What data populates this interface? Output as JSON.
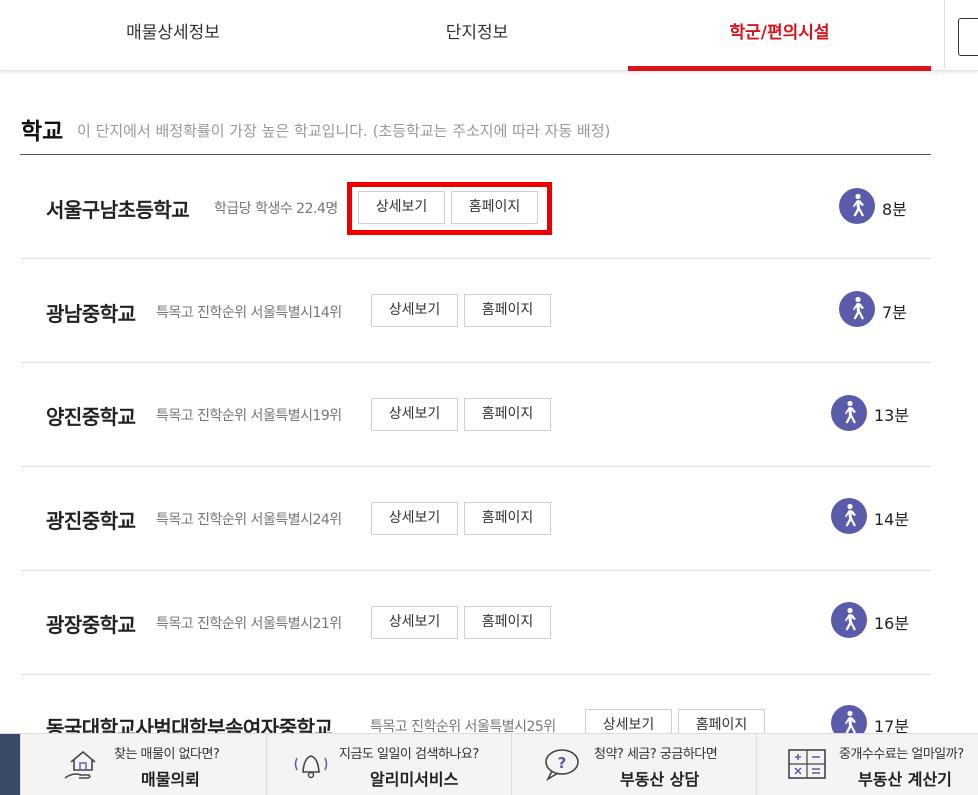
{
  "tabs": [
    {
      "label": "매물상세정보"
    },
    {
      "label": "단지정보"
    },
    {
      "label": "학군/편의시설"
    }
  ],
  "section": {
    "title": "학교",
    "description": "이 단지에서 배정확률이 가장 높은 학교입니다. (초등학교는 주소지에 따라 자동 배정)"
  },
  "buttons": {
    "detail": "상세보기",
    "homepage": "홈페이지"
  },
  "schools": [
    {
      "name": "서울구남초등학교",
      "info": "학급당 학생수 22.4명",
      "minutes": "8분"
    },
    {
      "name": "광남중학교",
      "info": "특목고 진학순위 서울특별시14위",
      "minutes": "7분"
    },
    {
      "name": "양진중학교",
      "info": "특목고 진학순위 서울특별시19위",
      "minutes": "13분"
    },
    {
      "name": "광진중학교",
      "info": "특목고 진학순위 서울특별시24위",
      "minutes": "14분"
    },
    {
      "name": "광장중학교",
      "info": "특목고 진학순위 서울특별시21위",
      "minutes": "16분"
    },
    {
      "name": "동국대학교사범대학부속여자중학교",
      "info": "특목고 진학순위 서울특별시25위",
      "minutes": "17분"
    }
  ],
  "bottom_bar": [
    {
      "sub": "찾는 매물이 없다면?",
      "main": "매물의뢰",
      "icon": "house-hand-icon"
    },
    {
      "sub": "지금도 일일이 검색하나요?",
      "main": "알리미서비스",
      "icon": "bell-icon"
    },
    {
      "sub": "청약? 세금? 궁금하다면",
      "main": "부동산 상담",
      "icon": "question-bubble-icon"
    },
    {
      "sub": "중개수수료는 얼마일까?",
      "main": "부동산 계산기",
      "icon": "calculator-icon"
    }
  ],
  "colors": {
    "accent": "#d9131a",
    "walk_icon": "#5b5bab",
    "highlight": "#ee0000"
  }
}
